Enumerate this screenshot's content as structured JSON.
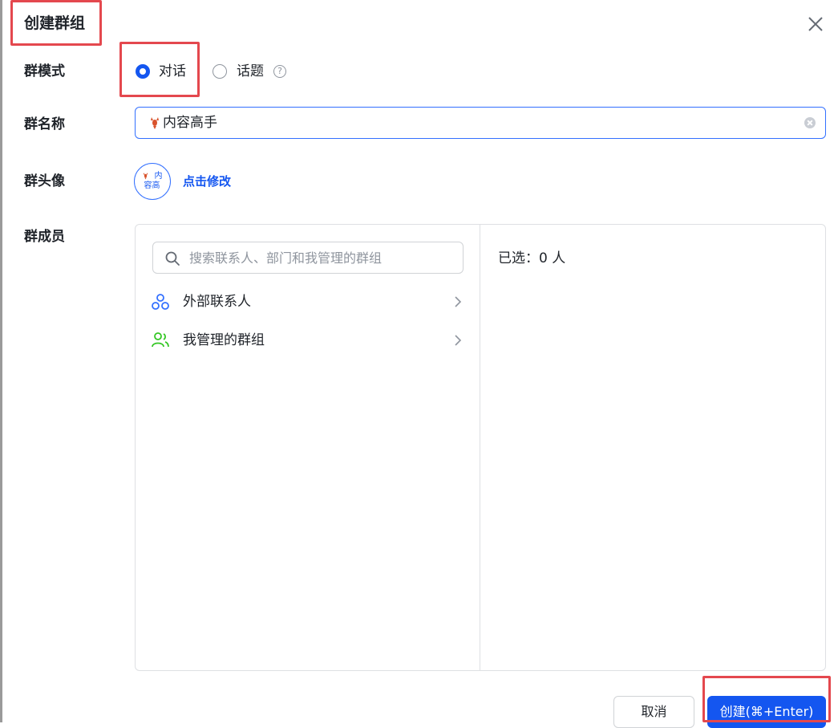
{
  "dialog": {
    "title": "创建群组",
    "close_icon": "close-icon"
  },
  "group_mode": {
    "label": "群模式",
    "options": [
      {
        "label": "对话",
        "selected": true
      },
      {
        "label": "话题",
        "selected": false
      }
    ],
    "help_icon": "question-circle-icon"
  },
  "group_name": {
    "label": "群名称",
    "value": "内容高手",
    "emoji_icon": "lobster-emoji-icon",
    "clear_icon": "clear-circle-icon"
  },
  "group_avatar": {
    "label": "群头像",
    "avatar_text_line1": "内",
    "avatar_text_line2": "容高",
    "edit_link": "点击修改"
  },
  "group_members": {
    "label": "群成员",
    "search_placeholder": "搜索联系人、部门和我管理的群组",
    "list": [
      {
        "label": "外部联系人",
        "icon": "external-contacts-icon"
      },
      {
        "label": "我管理的群组",
        "icon": "managed-groups-icon"
      }
    ],
    "selected_text": "已选：0 人"
  },
  "footer": {
    "cancel_label": "取消",
    "create_label": "创建(⌘+Enter)"
  },
  "colors": {
    "accent": "#1456f0",
    "highlight_box": "#e4484e",
    "external_icon": "#3370ff",
    "managed_icon": "#34c724"
  }
}
